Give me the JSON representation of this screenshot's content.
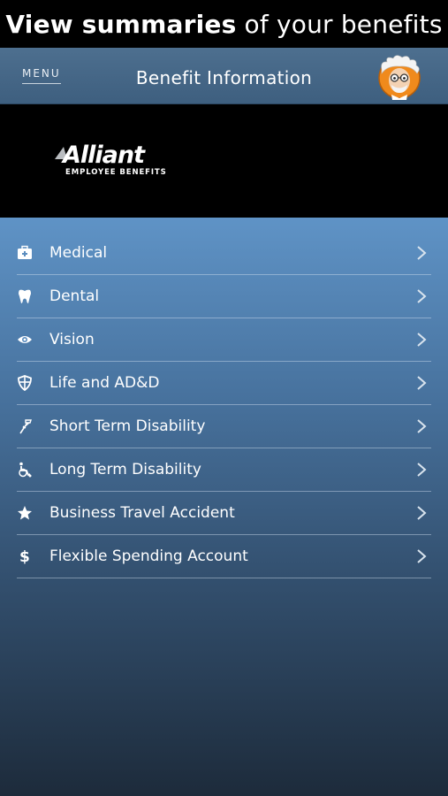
{
  "banner": {
    "bold_text": "View summaries",
    "rest_text": "of your benefits"
  },
  "navbar": {
    "menu_label": "MENU",
    "title": "Benefit Information",
    "avatar_icon": "professor-avatar-icon"
  },
  "logo": {
    "brand": "Alliant",
    "tagline": "EMPLOYEE BENEFITS"
  },
  "menu": {
    "items": [
      {
        "label": "Medical",
        "icon": "medical-kit-icon"
      },
      {
        "label": "Dental",
        "icon": "tooth-icon"
      },
      {
        "label": "Vision",
        "icon": "eye-icon"
      },
      {
        "label": "Life and AD&D",
        "icon": "shield-icon"
      },
      {
        "label": "Short Term Disability",
        "icon": "crutch-icon"
      },
      {
        "label": "Long Term Disability",
        "icon": "wheelchair-icon"
      },
      {
        "label": "Business Travel Accident",
        "icon": "star-icon"
      },
      {
        "label": "Flexible Spending Account",
        "icon": "dollar-icon"
      }
    ]
  },
  "colors": {
    "navbar": "#4d6f8f",
    "content_top": "#5f93c6",
    "content_bottom": "#1d2b3b",
    "avatar_orange": "#f08a1c"
  }
}
